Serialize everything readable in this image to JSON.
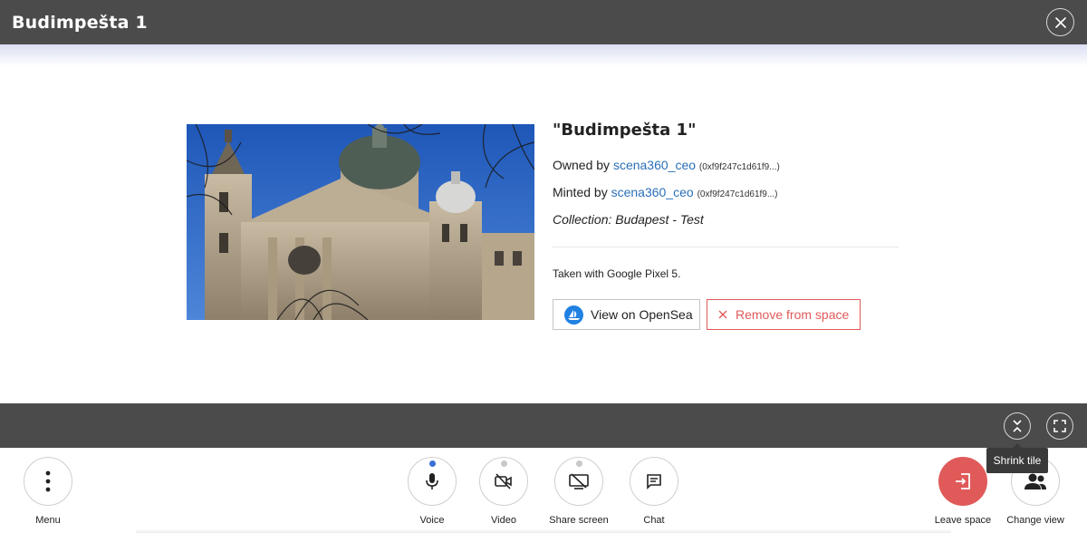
{
  "header": {
    "title": "Budimpešta 1",
    "close_icon": "close-icon"
  },
  "nft": {
    "image_alt": "St. Stephen's Basilica, Budapest",
    "title": "\"Budimpešta 1\"",
    "owned_prefix": "Owned by",
    "owner_name": "scena360_ceo",
    "owner_address": "(0xf9f247c1d61f9...)",
    "minted_prefix": "Minted by",
    "minter_name": "scena360_ceo",
    "minter_address": "(0xf9f247c1d61f9...)",
    "collection": "Collection: Budapest - Test",
    "description": "Taken with Google Pixel 5.",
    "view_button": "View on OpenSea",
    "remove_button": "Remove from space"
  },
  "tile_controls": {
    "shrink_icon": "collapse-icon",
    "fullscreen_icon": "fullscreen-icon",
    "tooltip": "Shrink tile"
  },
  "toolbar": {
    "menu": "Menu",
    "voice": "Voice",
    "video": "Video",
    "share_screen": "Share screen",
    "chat": "Chat",
    "leave_space": "Leave space",
    "change_view": "Change view"
  },
  "colors": {
    "header_bg": "#4b4b4b",
    "link": "#2a6fb8",
    "danger": "#e05a5a",
    "active_dot": "#3a6fd6",
    "opensea": "#2081e2"
  }
}
